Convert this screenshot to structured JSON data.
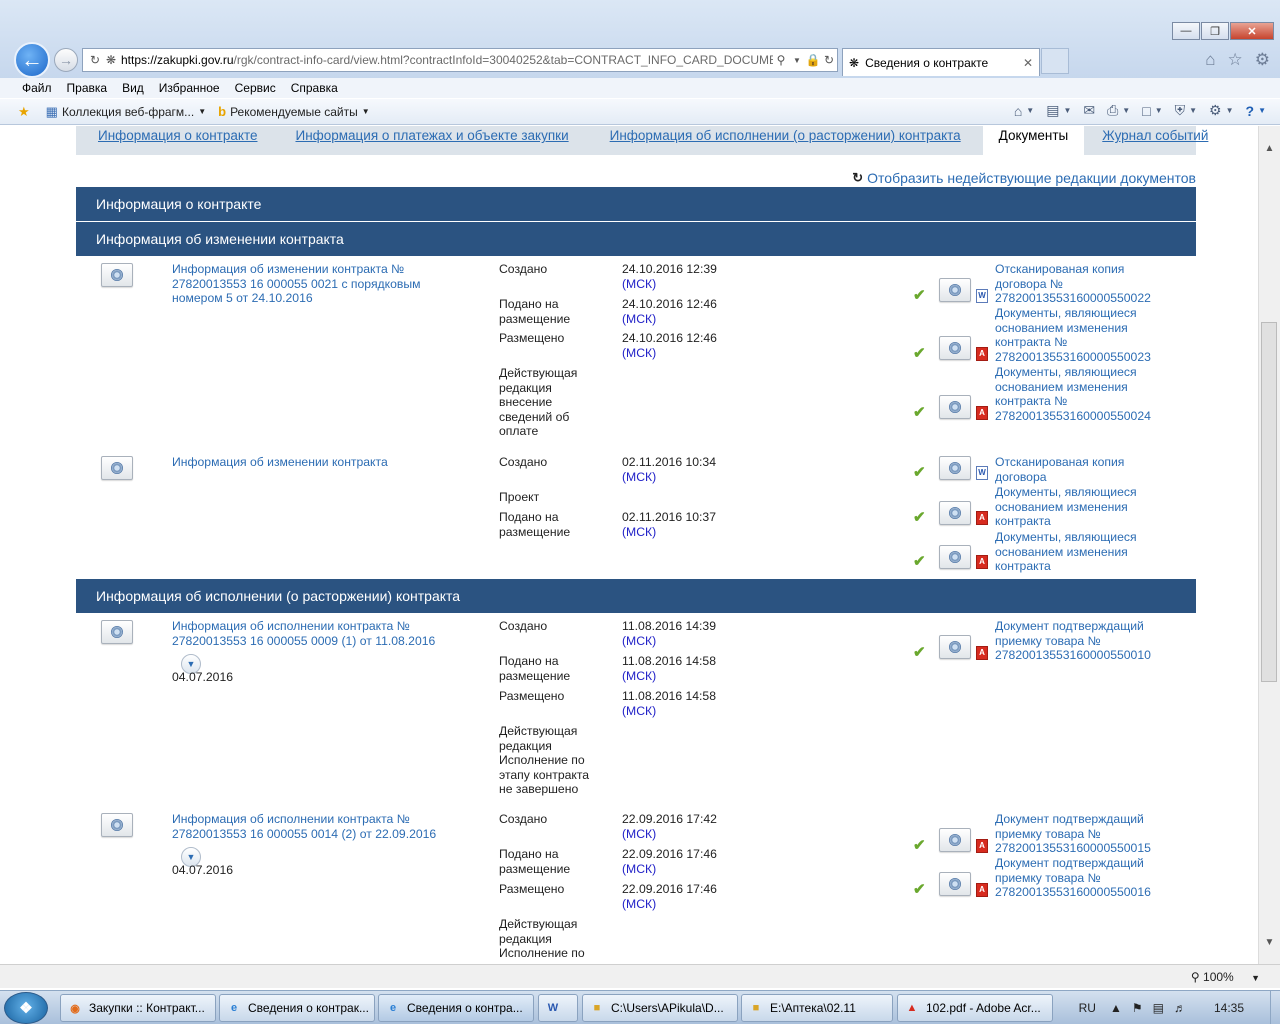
{
  "browser": {
    "url_host": "https://zakupki.gov.ru",
    "url_path": "/rgk/contract-info-card/view.html?contractInfoId=30040252&tab=CONTRACT_INFO_CARD_DOCUMEI",
    "tab_title": "Сведения о контракте",
    "menu": [
      "Файл",
      "Правка",
      "Вид",
      "Избранное",
      "Сервис",
      "Справка"
    ],
    "favorites": [
      "Коллекция веб-фрагм...",
      "Рекомендуемые сайты"
    ],
    "zoom": "100%"
  },
  "tabs": {
    "contract_info": "Информация о контракте",
    "payments": "Информация о платежах и объекте закупки",
    "execution": "Информация об исполнении (о расторжении) контракта",
    "documents": "Документы",
    "journal": "Журнал событий"
  },
  "show_inactive": "Отобразить недействующие редакции документов",
  "sections": {
    "contract": "Информация о контракте",
    "changes": "Информация об изменении контракта",
    "execution": "Информация об исполнении (о расторжении) контракта"
  },
  "labels": {
    "created": "Создано",
    "submitted": "Подано на размещение",
    "placed": "Размещено",
    "project": "Проект",
    "msk": "(МСК)"
  },
  "change1": {
    "title": "Информация об изменении контракта № 27820013553 16 000055 0021 с порядковым номером 5 от 24.10.2016",
    "created": "24.10.2016 12:39",
    "submitted": "24.10.2016 12:46",
    "placed": "24.10.2016 12:46",
    "status": "Действующая редакция внесение сведений об оплате",
    "files": [
      "Отсканированая копия договора № 27820013553160000550022",
      "Документы, являющиеся основанием изменения контракта № 27820013553160000550023",
      "Документы, являющиеся основанием изменения контракта № 27820013553160000550024"
    ]
  },
  "change2": {
    "title": "Информация об изменении контракта",
    "created": "02.11.2016 10:34",
    "submitted": "02.11.2016 10:37",
    "files": [
      "Отсканированая копия договора",
      "Документы, являющиеся основанием изменения контракта",
      "Документы, являющиеся основанием изменения контракта"
    ]
  },
  "exec1": {
    "title": "Информация об исполнении контракта № 27820013553 16 000055 0009 (1) от 11.08.2016",
    "date": "04.07.2016",
    "created": "11.08.2016 14:39",
    "submitted": "11.08.2016 14:58",
    "placed": "11.08.2016 14:58",
    "status": "Действующая редакция Исполнение по этапу контракта не завершено",
    "files": [
      "Документ подтверждащий приемку товара № 27820013553160000550010"
    ]
  },
  "exec2": {
    "title": "Информация об исполнении контракта № 27820013553 16 000055 0014 (2) от 22.09.2016",
    "date": "04.07.2016",
    "created": "22.09.2016 17:42",
    "submitted": "22.09.2016 17:46",
    "placed": "22.09.2016 17:46",
    "status": "Действующая редакция Исполнение по этапу контракта",
    "files": [
      "Документ подтверждащий приемку товара № 27820013553160000550015",
      "Документ подтверждащий приемку товара № 27820013553160000550016"
    ]
  },
  "taskbar": {
    "items": [
      "Закупки :: Контракт...",
      "Сведения о контрак...",
      "Сведения о контра...",
      "",
      "C:\\Users\\APikula\\D...",
      "E:\\Аптека\\02.11",
      "102.pdf - Adobe Acr..."
    ],
    "lang": "RU",
    "clock": "14:35"
  }
}
